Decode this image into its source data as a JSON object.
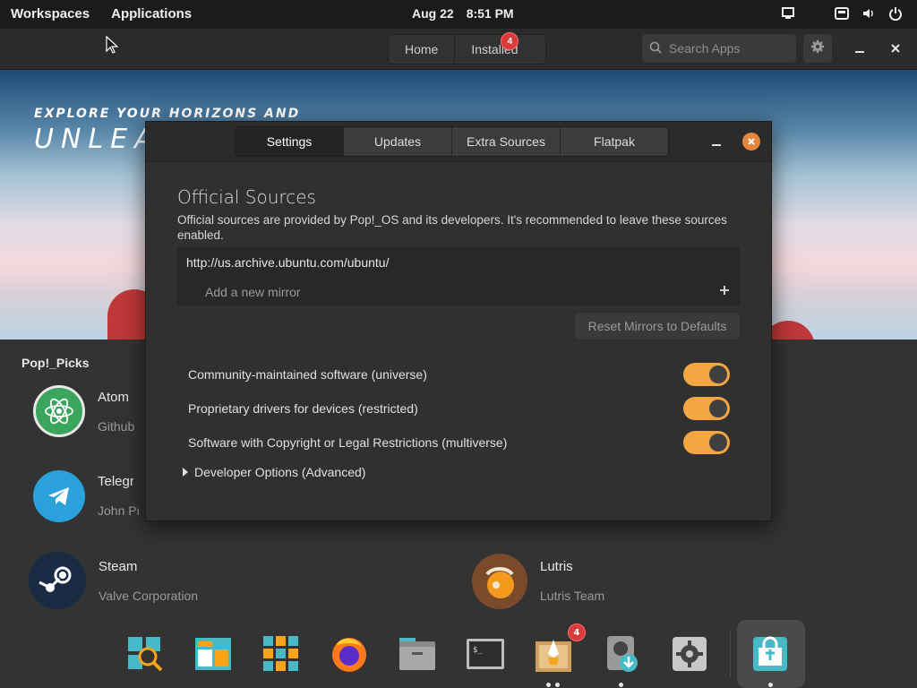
{
  "topbar": {
    "workspaces": "Workspaces",
    "applications": "Applications",
    "date": "Aug 22",
    "time": "8:51 PM"
  },
  "header": {
    "home_label": "Home",
    "installed_label": "Installed",
    "installed_badge": "4",
    "search_placeholder": "Search Apps"
  },
  "banner": {
    "kicker": "EXPLORE YOUR HORIZONS AND",
    "headline": "UNLEAS"
  },
  "picks": {
    "title": "Pop!_Picks",
    "apps": [
      {
        "name": "Atom",
        "author": "Github"
      },
      {
        "name": "Telegram",
        "author": "John Preston"
      },
      {
        "name": "Steam",
        "author": "Valve Corporation"
      },
      {
        "name": "Lutris",
        "author": "Lutris Team"
      }
    ]
  },
  "dialog": {
    "tabs": [
      "Settings",
      "Updates",
      "Extra Sources",
      "Flatpak"
    ],
    "active_tab": "Settings",
    "section_title": "Official Sources",
    "section_desc": "Official sources are provided by Pop!_OS and its developers. It's recommended to leave these sources enabled.",
    "mirror": "http://us.archive.ubuntu.com/ubuntu/",
    "add_mirror_placeholder": "Add a new mirror",
    "reset_label": "Reset Mirrors to Defaults",
    "toggles": [
      {
        "label": "Community-maintained software (universe)",
        "on": true
      },
      {
        "label": "Proprietary drivers for devices (restricted)",
        "on": true
      },
      {
        "label": "Software with Copyright or Legal Restrictions (multiverse)",
        "on": true
      }
    ],
    "developer_options": "Developer Options (Advanced)"
  },
  "dock": {
    "items": [
      "search-app",
      "file-manager",
      "app-library",
      "firefox",
      "files",
      "terminal",
      "rocket-app",
      "backup-app",
      "settings",
      "pop-shop"
    ],
    "rocket_badge": "4"
  },
  "colors": {
    "accent": "#f3a642",
    "close": "#e6863a",
    "badge": "#d93a3a"
  }
}
